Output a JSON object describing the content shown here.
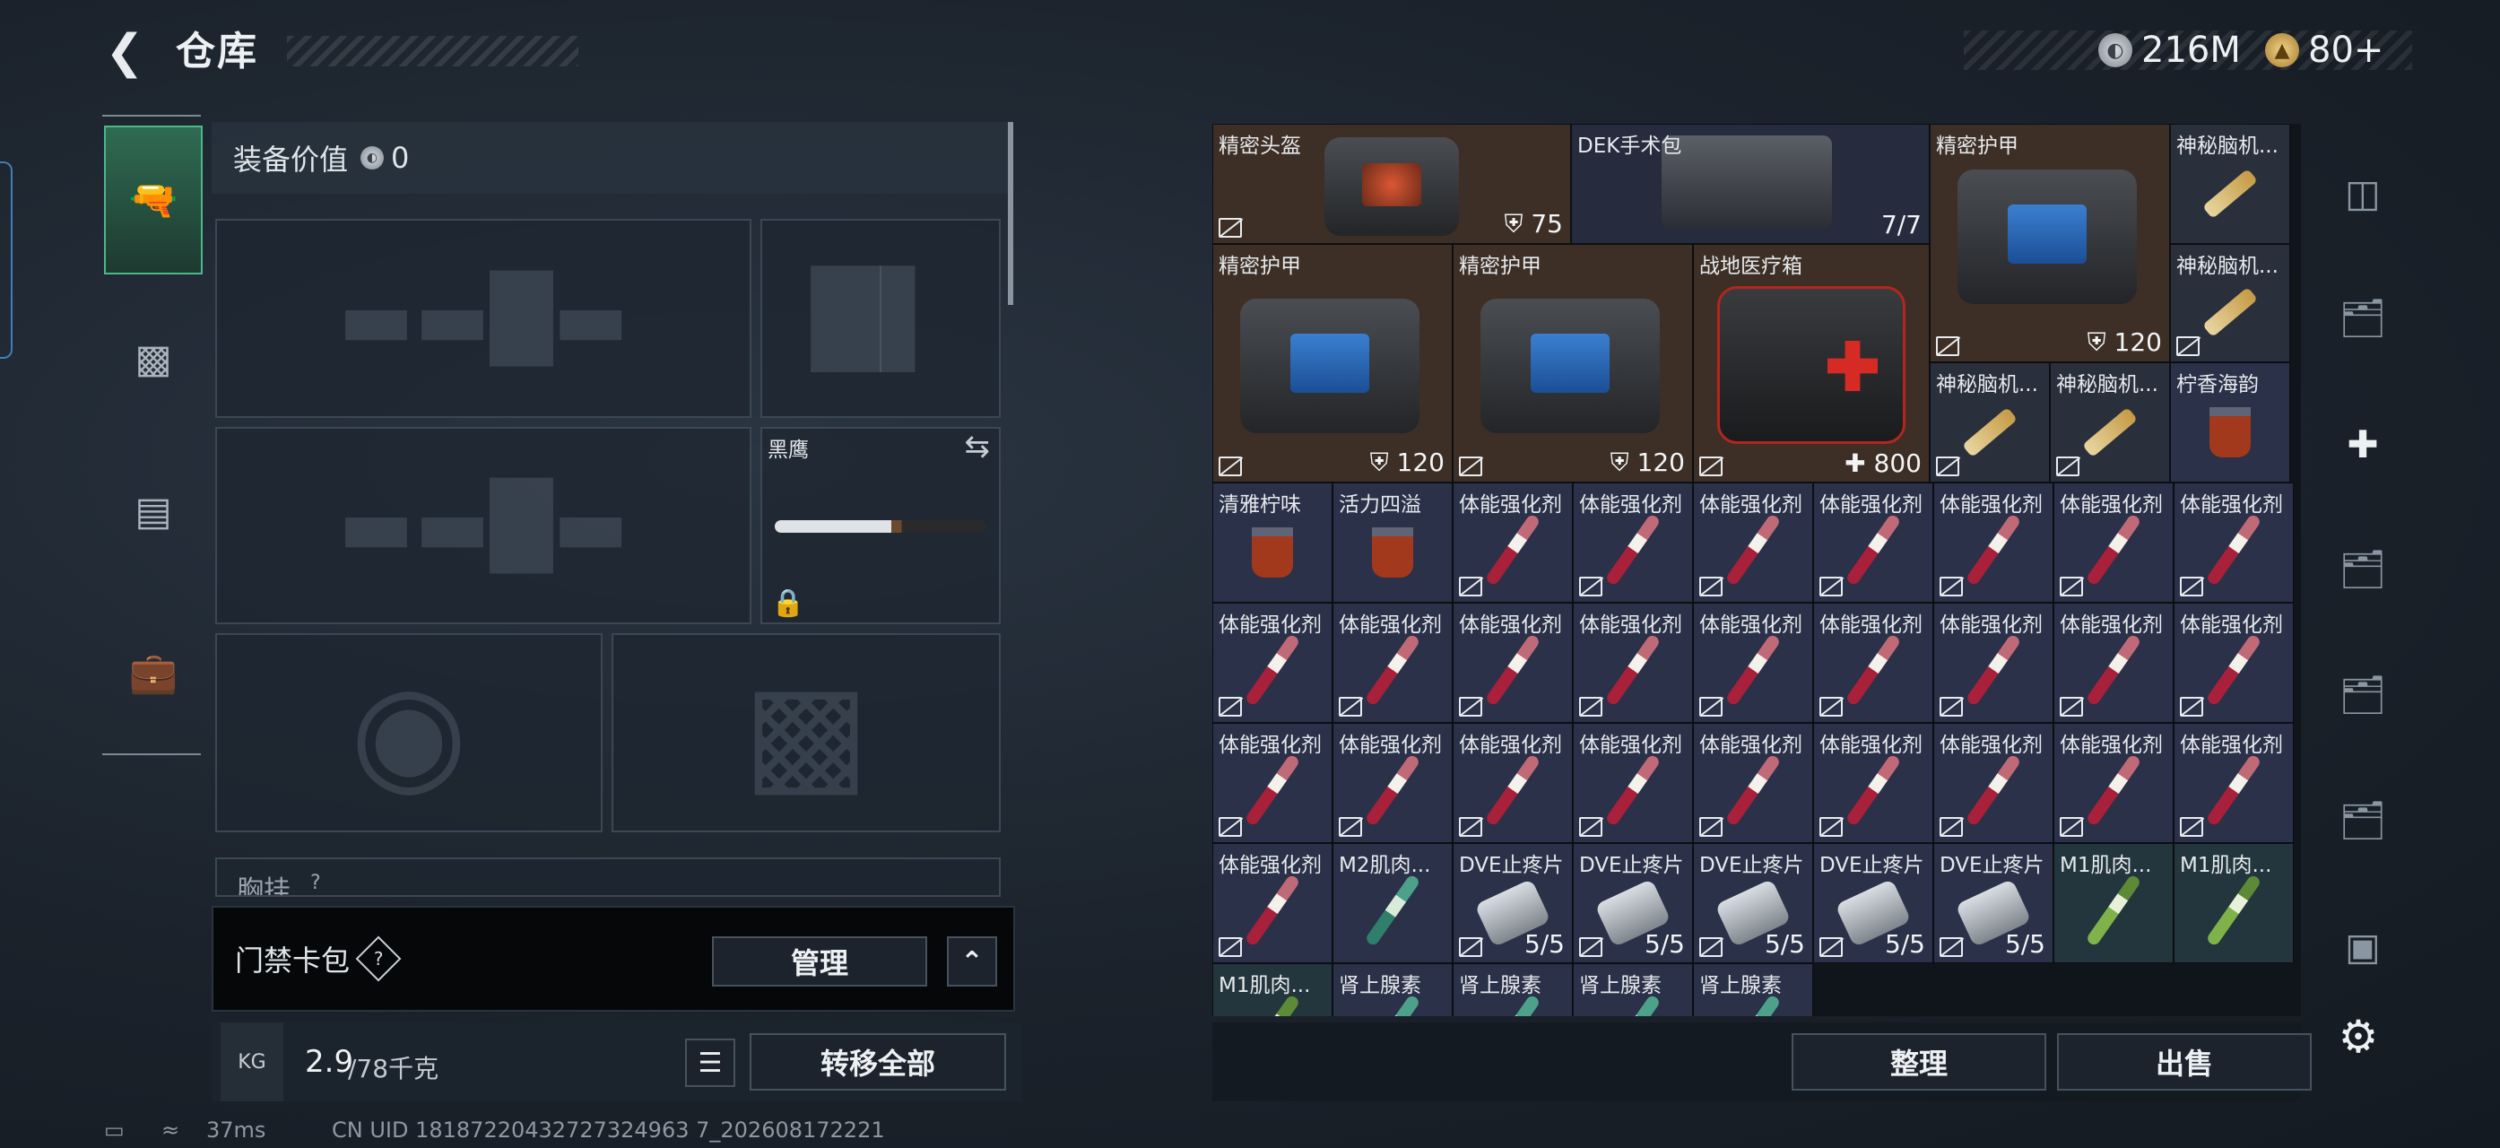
{
  "header": {
    "back_icon": "back-arrow-icon",
    "title": "仓库"
  },
  "currency": [
    {
      "icon": "silver-coin-icon",
      "value": "216M"
    },
    {
      "icon": "gold-coin-icon",
      "value": "80+"
    }
  ],
  "left_nav": [
    {
      "icon": "pistol-icon",
      "active": true
    },
    {
      "icon": "backpack-badge-icon"
    },
    {
      "icon": "backpack-icon"
    },
    {
      "icon": "toolbox-icon"
    }
  ],
  "equipment": {
    "value_label": "装备价值",
    "value": "0",
    "knife_name": "黑鹰",
    "chest_label": "胸挂",
    "chest_help": "?"
  },
  "keycard": {
    "label": "门禁卡包",
    "help": "?",
    "manage_label": "管理"
  },
  "weight": {
    "current": "2.9",
    "max": "/78千克",
    "transfer_label": "转移全部",
    "kg_badge": "KG"
  },
  "inventory_actions": {
    "sort_label": "整理",
    "sell_label": "出售"
  },
  "inventory_items": [
    {
      "name": "精密头盔",
      "count": "75",
      "shield": true
    },
    {
      "name": "DEK手术包",
      "count": "7/7"
    },
    {
      "name": "精密护甲",
      "count": "120",
      "shield": true
    },
    {
      "name": "神秘脑机..."
    },
    {
      "name": "精密护甲",
      "count": "120",
      "shield": true
    },
    {
      "name": "精密护甲",
      "count": "120",
      "shield": true
    },
    {
      "name": "战地医疗箱",
      "count": "800",
      "plus": true
    },
    {
      "name": "神秘脑机..."
    },
    {
      "name": "神秘脑机..."
    },
    {
      "name": "神秘脑机..."
    },
    {
      "name": "柠香海韵"
    },
    {
      "name": "清雅柠味"
    },
    {
      "name": "活力四溢"
    },
    {
      "name": "体能强化剂"
    },
    {
      "name": "M2肌肉..."
    },
    {
      "name": "DVE止疼片",
      "count": "5/5"
    },
    {
      "name": "M1肌肉..."
    },
    {
      "name": "肾上腺素"
    }
  ],
  "status_bar": {
    "ping": "37ms",
    "uid": "CN UID 18187220432727324963 7_202608172221"
  }
}
